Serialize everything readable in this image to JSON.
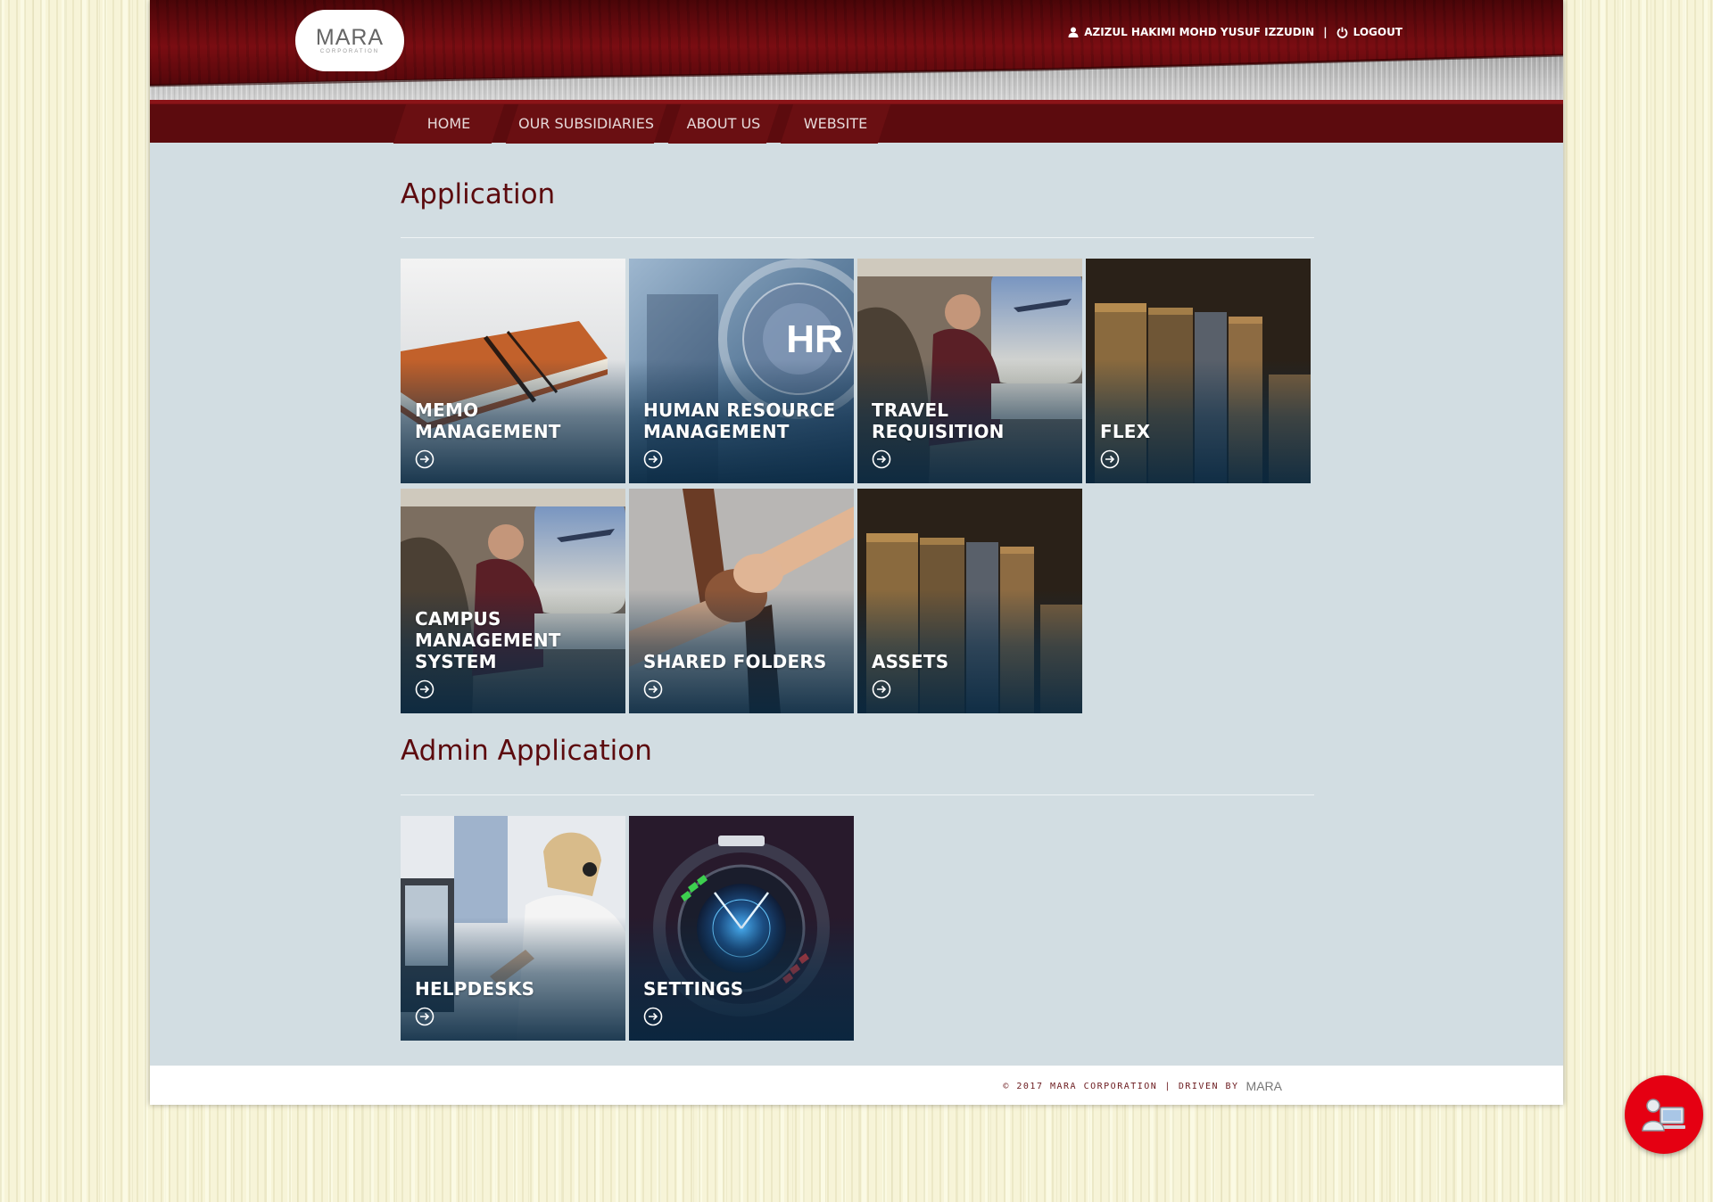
{
  "header": {
    "logo_text": "MARA",
    "logo_sub": "CORPORATION",
    "username": "AZIZUL HAKIMI MOHD YUSUF IZZUDIN",
    "separator": "|",
    "logout_label": "LOGOUT",
    "icons": [
      "user-icon",
      "power-icon"
    ]
  },
  "nav": {
    "items": [
      {
        "label": "HOME"
      },
      {
        "label": "OUR SUBSIDIARIES"
      },
      {
        "label": "ABOUT US"
      },
      {
        "label": "WEBSITE"
      }
    ]
  },
  "sections": {
    "application": {
      "title": "Application",
      "tiles": [
        {
          "label": "MEMO MANAGEMENT",
          "icon": "arrow-right-circle-icon"
        },
        {
          "label": "HUMAN RESOURCE MANAGEMENT",
          "icon": "arrow-right-circle-icon",
          "image_text": "HR"
        },
        {
          "label": "TRAVEL REQUISITION",
          "icon": "arrow-right-circle-icon"
        },
        {
          "label": "FLEX",
          "icon": "arrow-right-circle-icon"
        },
        {
          "label": "CAMPUS MANAGEMENT SYSTEM",
          "icon": "arrow-right-circle-icon"
        },
        {
          "label": "SHARED FOLDERS",
          "icon": "arrow-right-circle-icon"
        },
        {
          "label": "ASSETS",
          "icon": "arrow-right-circle-icon"
        }
      ]
    },
    "admin": {
      "title": "Admin Application",
      "tiles": [
        {
          "label": "HELPDESKS",
          "icon": "arrow-right-circle-icon"
        },
        {
          "label": "SETTINGS",
          "icon": "arrow-right-circle-icon"
        }
      ]
    }
  },
  "footer": {
    "copyright": "© 2017 MARA CORPORATION",
    "separator": "|",
    "driven_by": "DRIVEN BY",
    "logo_text": "MARA"
  },
  "colors": {
    "brand_red": "#5c0a0e",
    "header_red": "#7a0d12",
    "content_bg": "#d2dde2",
    "fab_red": "#e50012"
  }
}
